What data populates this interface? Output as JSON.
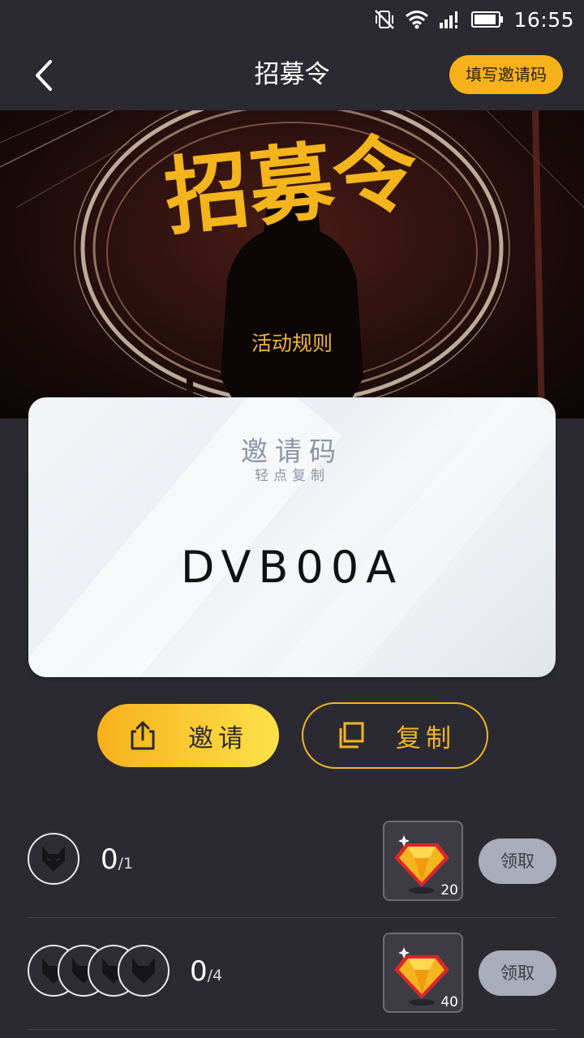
{
  "status_bar": {
    "time": "16:55"
  },
  "nav": {
    "title": "招募令",
    "invite_entry_label": "填写邀请码"
  },
  "banner": {
    "headline": "招募令",
    "rules_label": "活动规则"
  },
  "code_card": {
    "title": "邀请码",
    "subtitle": "轻点复制",
    "code": "DVB00A"
  },
  "actions": {
    "invite_label": "邀请",
    "copy_label": "复制"
  },
  "rewards": [
    {
      "progress": "0",
      "target": "1",
      "gem_amount": "20",
      "claim_label": "领取"
    },
    {
      "progress": "0",
      "target": "4",
      "gem_amount": "40",
      "claim_label": "领取"
    }
  ],
  "colors": {
    "accent": "#f7b21b",
    "background": "#2b2a33",
    "claim_disabled": "#a9adb9"
  }
}
